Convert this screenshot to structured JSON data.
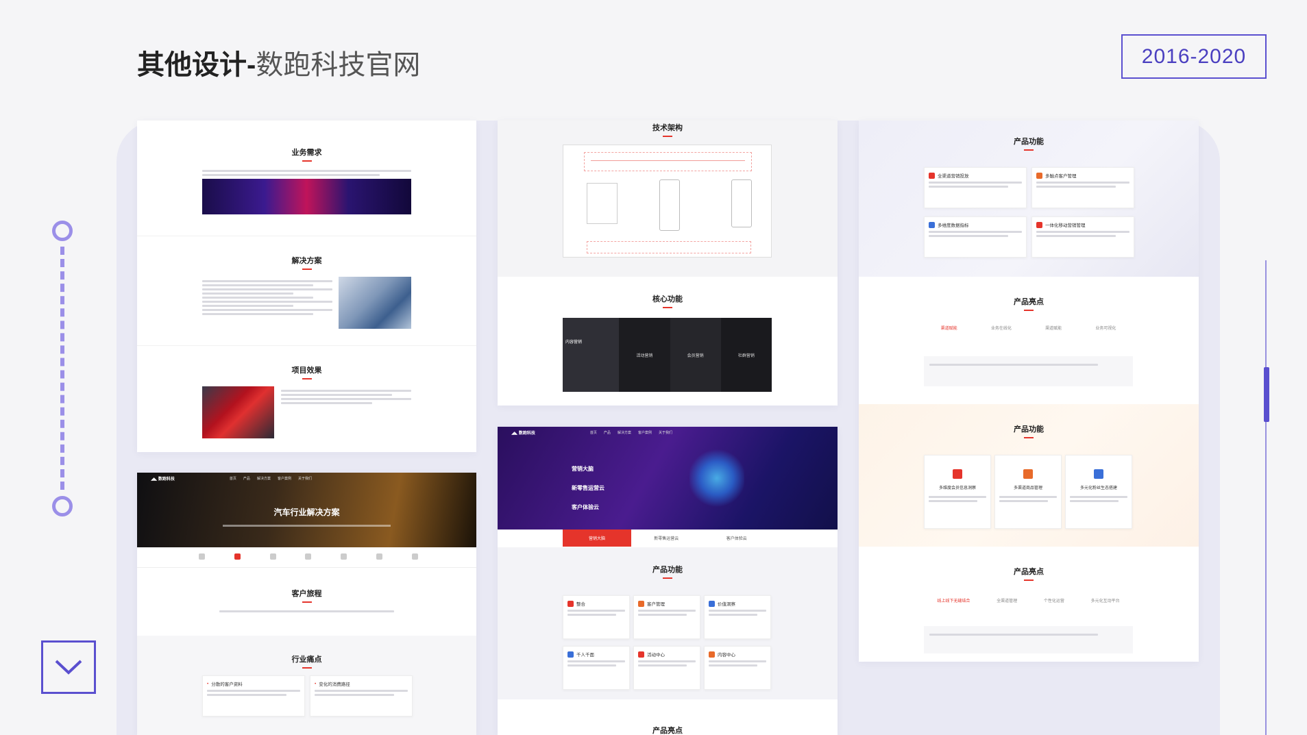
{
  "header": {
    "title_bold": "其他设计-",
    "title_light": "数跑科技官网",
    "year_range": "2016-2020"
  },
  "colors": {
    "accent": "#5a4fcf",
    "red": "#e5342b",
    "timeline": "#9b8fe8"
  },
  "icons": {
    "down": "chevron-down-icon"
  },
  "col1": {
    "business_title": "业务需求",
    "solution_title": "解决方案",
    "effect_title": "项目效果",
    "auto_hero_title": "汽车行业解决方案",
    "journey_title": "客户旅程",
    "pain_title": "行业痛点",
    "pain_items": [
      "分散的客户资料",
      "变化的消费路径"
    ]
  },
  "col2": {
    "arch_title": "技术架构",
    "core_title": "核心功能",
    "core_items": [
      "内容营销",
      "活动营销",
      "会员营销",
      "社群营销"
    ],
    "hero_lines": [
      "营销大脑",
      "新零售运营云",
      "客户体验云"
    ],
    "tabs": [
      "营销大脑",
      "新零售运营云",
      "客户体验云"
    ],
    "func_title": "产品功能",
    "func_items": [
      "整合",
      "客户管理",
      "价值洞察",
      "千人千面",
      "活动中心",
      "内容中心"
    ],
    "highlight_title": "产品亮点"
  },
  "col3": {
    "func_title_a": "产品功能",
    "func_items_a": [
      "全渠道营销投放",
      "多触点客户管理",
      "多维度数据指标",
      "一体化移动营销管理"
    ],
    "highlight_title_a": "产品亮点",
    "highlight_items_a": [
      "渠道赋能",
      "业务在线化",
      "渠道赋能",
      "业务可视化"
    ],
    "func_title_b": "产品功能",
    "func_items_b": [
      "多维度会员信息洞察",
      "多渠道商品管理",
      "多元化粉丝生态搭建"
    ],
    "highlight_title_b": "产品亮点",
    "highlight_items_b": [
      "线上线下无缝结合",
      "全渠道管理",
      "个性化运营",
      "多元化互动平台"
    ]
  }
}
